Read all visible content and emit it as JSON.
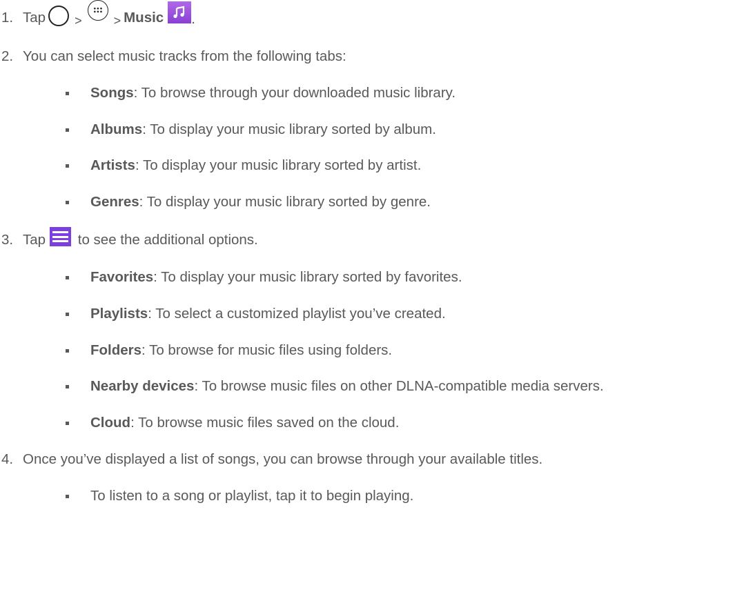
{
  "steps": [
    {
      "number": "1.",
      "tap": "Tap",
      "sep1": ">",
      "sep2": ">",
      "app": "Music",
      "period": ".",
      "icons": [
        "home-button-icon",
        "apps-launcher-icon",
        "music-app-icon"
      ]
    },
    {
      "number": "2.",
      "text": "You can select music tracks from the following tabs:",
      "items": [
        {
          "term": "Songs",
          "desc": ": To browse through your downloaded music library."
        },
        {
          "term": "Albums",
          "desc": ": To display your music library sorted by album."
        },
        {
          "term": "Artists",
          "desc": ": To display your music library sorted by artist."
        },
        {
          "term": "Genres",
          "desc": ": To display your music library sorted by genre."
        }
      ]
    },
    {
      "number": "3.",
      "tap": "Tap",
      "after": " to see the additional options.",
      "icon": "menu-icon",
      "items": [
        {
          "term": "Favorites",
          "desc": ": To display your music library sorted by favorites."
        },
        {
          "term": "Playlists",
          "desc": ": To select a customized playlist you’ve created."
        },
        {
          "term": "Folders",
          "desc": ": To browse for music files using folders."
        },
        {
          "term": "Nearby devices",
          "desc": ": To browse music files on other DLNA-compatible media servers."
        },
        {
          "term": "Cloud",
          "desc": ": To browse music files saved on the cloud."
        }
      ]
    },
    {
      "number": "4.",
      "text": "Once you’ve displayed a list of songs, you can browse through your available titles.",
      "items": [
        {
          "text": "To listen to a song or playlist, tap it to begin playing."
        }
      ]
    }
  ],
  "colors": {
    "text": "#595959",
    "music_icon": "#9b4fe0",
    "menu_icon": "#7d3fe0"
  }
}
